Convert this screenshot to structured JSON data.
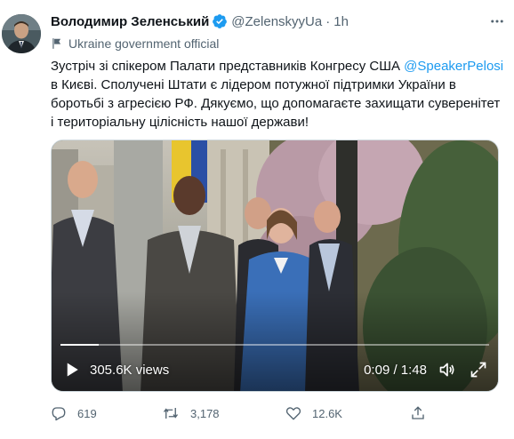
{
  "author": {
    "name": "Володимир Зеленський",
    "handle": "@ZelenskyyUa",
    "separator": "·",
    "time": "1h",
    "label": "Ukraine government official"
  },
  "tweet": {
    "text_before": "Зустріч зі спікером Палати представників Конгресу США ",
    "mention": "@SpeakerPelosi",
    "text_after": " в Києві. Сполучені Штати є лідером потужної підтримки України в боротьбі з агресією РФ. Дякуємо, що допомагаєте захищати суверенітет і територіальну цілісність нашої держави!"
  },
  "video": {
    "views": "305.6K views",
    "elapsed": "0:09 / 1:48",
    "progress_fraction": 0.09
  },
  "actions": {
    "replies": "619",
    "retweets": "3,178",
    "likes": "12.6K"
  },
  "colors": {
    "accent": "#1d9bf0",
    "secondary_text": "#536471",
    "verified_badge": "#1d9bf0"
  },
  "icons": {
    "verified": "verified-badge-icon",
    "more": "more-icon",
    "flag": "flag-icon",
    "play": "play-icon",
    "volume": "volume-icon",
    "fullscreen": "fullscreen-icon",
    "reply": "reply-icon",
    "retweet": "retweet-icon",
    "like": "like-icon",
    "share": "share-icon"
  }
}
